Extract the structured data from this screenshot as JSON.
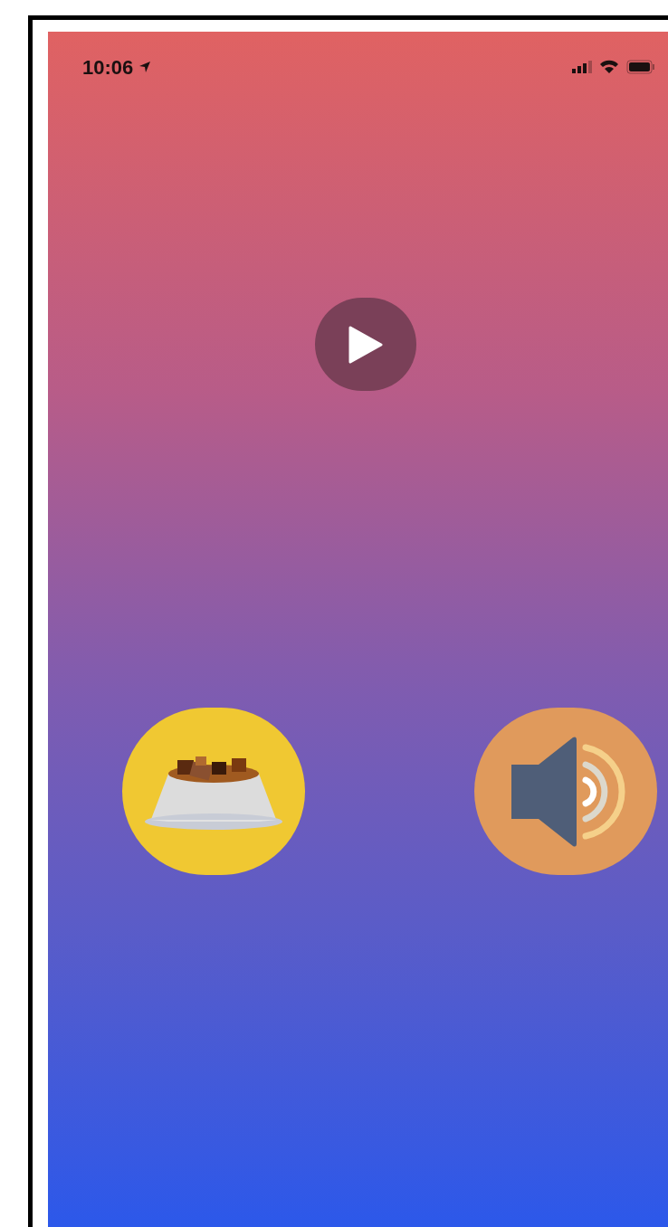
{
  "status_bar": {
    "time": "10:06"
  }
}
